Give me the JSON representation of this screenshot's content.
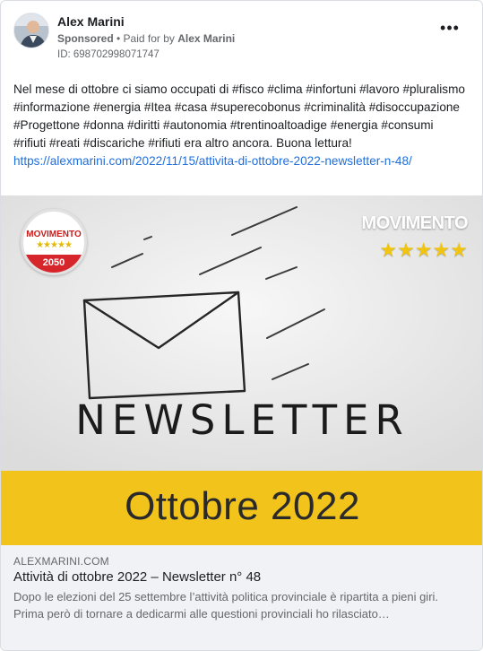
{
  "post": {
    "author": "Alex Marini",
    "sponsored_label": "Sponsored",
    "separator": " • ",
    "paid_for_label": "Paid for by ",
    "paid_for_name": "Alex Marini",
    "ad_id": "ID: 698702998071747",
    "more_icon": "more-horizontal-icon",
    "text": "Nel mese di ottobre ci siamo occupati di #fisco #clima #infortuni #lavoro #pluralismo #informazione #energia #Itea #casa #superecobonus #criminalità #disoccupazione #Progettone #donna #diritti #autonomia #trentinoaltoadige #energia #consumi #rifiuti #reati #discariche #rifiuti era altro ancora. Buona lettura!",
    "link": "https://alexmarini.com/2022/11/15/attivita-di-ottobre-2022-newsletter-n-48/"
  },
  "image": {
    "logo_left_brand": "MOVIMENTO",
    "logo_left_stars": "★★★★★",
    "logo_left_year": "2050",
    "logo_right_brand": "MOVIMENTO",
    "logo_right_stars": "★★★★★",
    "newsletter_word": "NEWSLETTER",
    "month_text": "Ottobre 2022",
    "colors": {
      "band": "#f2c31a",
      "background": "#eeeeee",
      "logo_red": "#d6252b"
    }
  },
  "link_preview": {
    "domain": "ALEXMARINI.COM",
    "title": "Attività di ottobre 2022 – Newsletter n° 48",
    "description": "Dopo le elezioni del 25 settembre l’attività politica provinciale è ripartita a pieni giri. Prima però di tornare a dedicarmi alle questioni provinciali ho rilasciato…"
  }
}
